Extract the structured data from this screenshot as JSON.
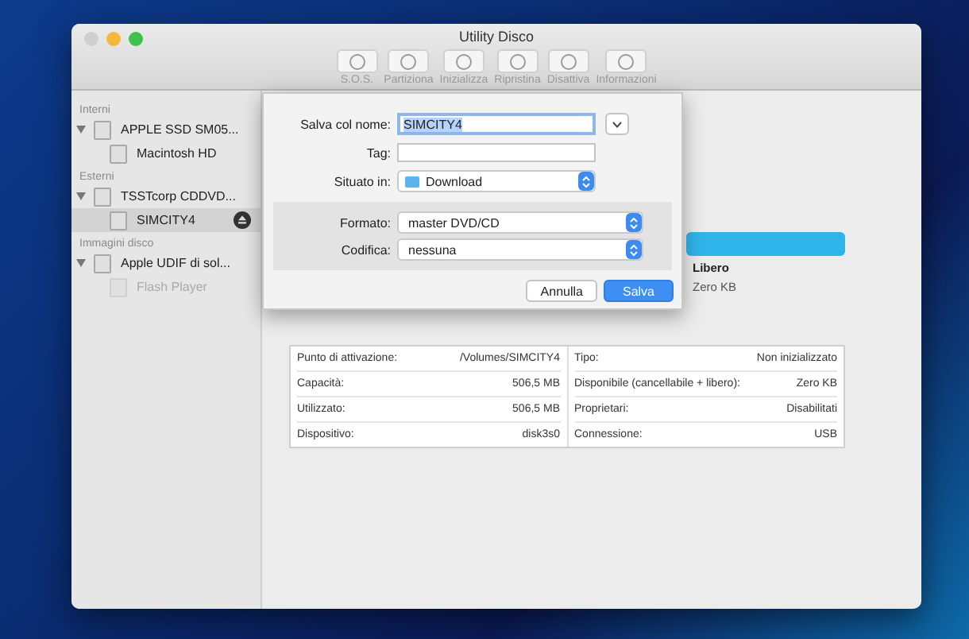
{
  "window": {
    "title": "Utility Disco"
  },
  "toolbar": [
    {
      "label": "S.O.S.",
      "disabled": true
    },
    {
      "label": "Partiziona",
      "disabled": true
    },
    {
      "label": "Inizializza",
      "disabled": true
    },
    {
      "label": "Ripristina",
      "disabled": true
    },
    {
      "label": "Disattiva",
      "disabled": true
    },
    {
      "label": "Informazioni",
      "disabled": true
    }
  ],
  "sidebar": {
    "sections": [
      {
        "title": "Interni",
        "items": [
          {
            "label": "APPLE SSD SM05...",
            "expanded": true,
            "selected": false,
            "disabled": false,
            "children": [
              {
                "label": "Macintosh HD",
                "selected": false,
                "disabled": false,
                "eject": false
              }
            ]
          }
        ]
      },
      {
        "title": "Esterni",
        "items": [
          {
            "label": "TSSTcorp CDDVD...",
            "expanded": true,
            "selected": false,
            "disabled": false,
            "children": [
              {
                "label": "SIMCITY4",
                "selected": true,
                "disabled": false,
                "eject": true
              }
            ]
          }
        ]
      },
      {
        "title": "Immagini disco",
        "items": [
          {
            "label": "Apple UDIF di sol...",
            "expanded": true,
            "selected": false,
            "disabled": false,
            "children": [
              {
                "label": "Flash Player",
                "selected": false,
                "disabled": true,
                "eject": false
              }
            ]
          }
        ]
      }
    ]
  },
  "usage": {
    "level": 1,
    "legend_label": "Libero",
    "legend_value": "Zero KB"
  },
  "info": {
    "rows": [
      {
        "label": "Punto di attivazione:",
        "value": "/Volumes/SIMCITY4",
        "label_2": "Tipo:",
        "value_2": "Non inizializzato"
      },
      {
        "label": "Capacità:",
        "value": "506,5 MB",
        "label_2": "Disponibile (cancellabile + libero):",
        "value_2": "Zero KB"
      },
      {
        "label": "Utilizzato:",
        "value": "506,5 MB",
        "label_2": "Proprietari:",
        "value_2": "Disabilitati"
      },
      {
        "label": "Dispositivo:",
        "value": "disk3s0",
        "label_2": "Connessione:",
        "value_2": "USB"
      }
    ]
  },
  "save_sheet": {
    "name": {
      "label": "Salva col nome:",
      "value": "SIMCITY4"
    },
    "tag": {
      "label": "Tag:"
    },
    "location": {
      "label": "Situato in:",
      "value": "Download"
    },
    "format": {
      "label": "Formato:",
      "value": "master DVD/CD"
    },
    "encoding": {
      "label": "Codifica:",
      "value": "nessuna"
    },
    "buttons": [
      {
        "label": "Annulla",
        "kind": "secondary"
      },
      {
        "label": "Salva",
        "kind": "default"
      }
    ]
  }
}
